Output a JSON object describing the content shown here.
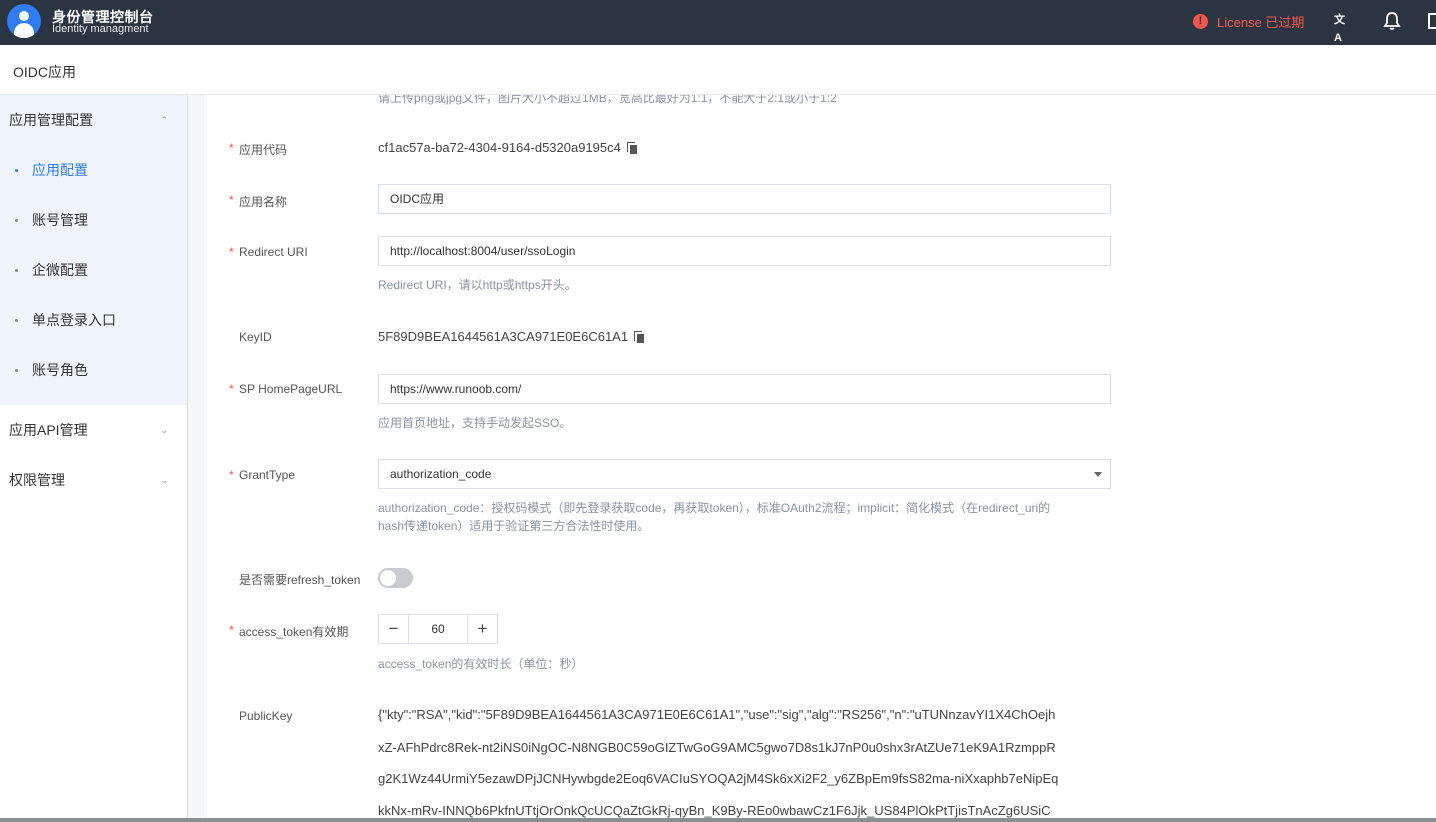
{
  "header": {
    "brand_title": "身份管理控制台",
    "brand_subtitle": "Identity managment",
    "license_text": "License 已过期",
    "license_icon_glyph": "!",
    "lang_icon_glyph": "文A"
  },
  "page": {
    "title": "OIDC应用"
  },
  "sidebar": {
    "groups": [
      {
        "label": "应用管理配置",
        "expanded": true,
        "items": [
          {
            "label": "应用配置",
            "active": true
          },
          {
            "label": "账号管理"
          },
          {
            "label": "企微配置"
          },
          {
            "label": "单点登录入口"
          },
          {
            "label": "账号角色"
          }
        ]
      },
      {
        "label": "应用API管理",
        "expanded": false
      },
      {
        "label": "权限管理",
        "expanded": false
      }
    ],
    "chevron_up": "⌃",
    "chevron_down": "⌄"
  },
  "form": {
    "upload_hint": "请上传png或jpg文件，图片大小不超过1MB，宽高比最好为1:1，不能大于2:1或小于1:2",
    "required_mark": "*",
    "app_code": {
      "label": "应用代码",
      "value": "cf1ac57a-ba72-4304-9164-d5320a9195c4"
    },
    "app_name": {
      "label": "应用名称",
      "value": "OIDC应用"
    },
    "redirect_uri": {
      "label": "Redirect URI",
      "value": "http://localhost:8004/user/ssoLogin",
      "help": "Redirect URI，请以http或https开头。"
    },
    "key_id": {
      "label": "KeyID",
      "value": "5F89D9BEA1644561A3CA971E0E6C61A1"
    },
    "homepage": {
      "label": "SP HomePageURL",
      "value": "https://www.runoob.com/",
      "help": "应用首页地址，支持手动发起SSO。"
    },
    "grant_type": {
      "label": "GrantType",
      "value": "authorization_code",
      "help_line1": "authorization_code：授权码模式（即先登录获取code，再获取token），标准OAuth2流程；implicit：简化模式（在redirect_uri的",
      "help_line2": "hash传递token）适用于验证第三方合法性时使用。"
    },
    "refresh_token": {
      "label": "是否需要refresh_token",
      "enabled": false
    },
    "access_token": {
      "label": "access_token有效期",
      "value": "60",
      "minus": "−",
      "plus": "+",
      "help": "access_token的有效时长（单位：秒）"
    },
    "public_key": {
      "label": "PublicKey",
      "lines": [
        "{\"kty\":\"RSA\",\"kid\":\"5F89D9BEA1644561A3CA971E0E6C61A1\",\"use\":\"sig\",\"alg\":\"RS256\",\"n\":\"uTUNnzavYI1X4ChOejh",
        "xZ-AFhPdrc8Rek-nt2iNS0iNgOC-N8NGB0C59oGIZTwGoG9AMC5gwo7D8s1kJ7nP0u0shx3rAtZUe71eK9A1RzmppR",
        "g2K1Wz44UrmiY5ezawDPjJCNHywbgde2Eoq6VACIuSYOQA2jM4Sk6xXi2F2_y6ZBpEm9fsS82ma-niXxaphb7eNipEq",
        "kkNx-mRv-INNQb6PkfnUTtjOrOnkQcUCQaZtGkRj-qyBn_K9By-REo0wbawCz1F6Jjk_US84PlOkPtTjisTnAcZg6USiC"
      ]
    }
  }
}
